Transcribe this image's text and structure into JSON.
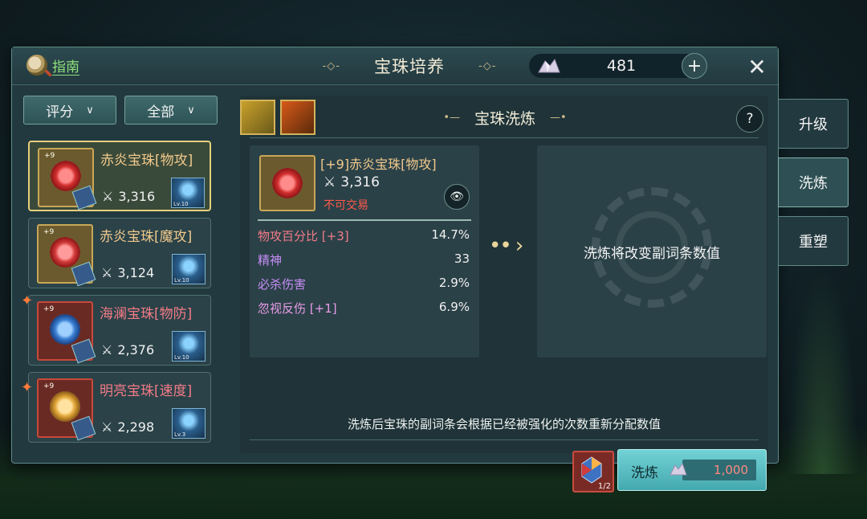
{
  "header": {
    "guide_label": "指南",
    "title": "宝珠培养",
    "currency_amount": "481"
  },
  "filters": {
    "sort_label": "评分",
    "type_label": "全部"
  },
  "list": [
    {
      "level": "+9",
      "name": "赤炎宝珠[物攻]",
      "score": "3,316",
      "pet_lv": "Lv.10",
      "selected": true
    },
    {
      "level": "+9",
      "name": "赤炎宝珠[魔攻]",
      "score": "3,124",
      "pet_lv": "Lv.10",
      "selected": false
    },
    {
      "level": "+9",
      "name": "海澜宝珠[物防]",
      "score": "2,376",
      "pet_lv": "Lv.10",
      "selected": false
    },
    {
      "level": "+9",
      "name": "明亮宝珠[速度]",
      "score": "2,298",
      "pet_lv": "Lv.3",
      "selected": false
    }
  ],
  "side_tabs": [
    "升级",
    "洗炼",
    "重塑"
  ],
  "section": {
    "title": "宝珠洗炼",
    "help": "?"
  },
  "detail": {
    "name": "[+9]赤炎宝珠[物攻]",
    "score": "3,316",
    "untradeable": "不可交易",
    "stats": [
      {
        "label": "物攻百分比 [+3]",
        "value": "14.7%"
      },
      {
        "label": "精神",
        "value": "33"
      },
      {
        "label": "必杀伤害",
        "value": "2.9%"
      },
      {
        "label": "忽视反伤 [+1]",
        "value": "6.9%"
      }
    ]
  },
  "preview": {
    "text": "洗炼将改变副词条数值"
  },
  "note": "洗炼后宝珠的副词条会根据已经被强化的次数重新分配数值",
  "action": {
    "consume_count": "1/2",
    "wash_label": "洗炼",
    "wash_cost": "1,000"
  },
  "colors": {
    "accent": "#e6cf7c",
    "stat_red": "#f37b87",
    "stat_purple": "#c68ef6",
    "cost_red": "#ff8a80",
    "button_cyan": "#5fc2c7"
  }
}
